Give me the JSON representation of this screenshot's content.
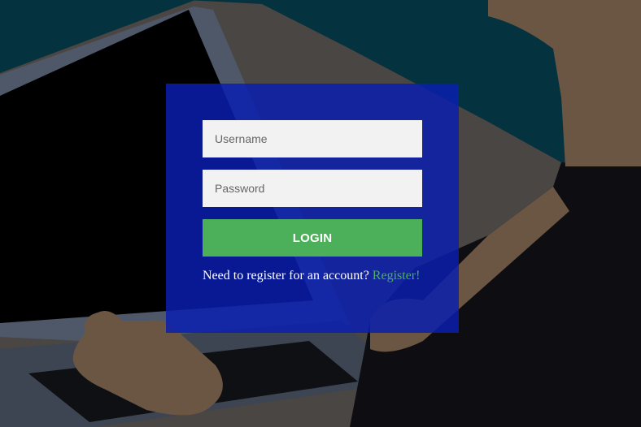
{
  "login": {
    "username_placeholder": "Username",
    "password_placeholder": "Password",
    "login_label": "LOGIN",
    "register_prompt": "Need to register for an account?",
    "register_link": "Register!"
  },
  "colors": {
    "panel": "#0a1eaf",
    "button": "#4caf5a",
    "link": "#4caf5a",
    "input_bg": "#f2f2f2"
  }
}
